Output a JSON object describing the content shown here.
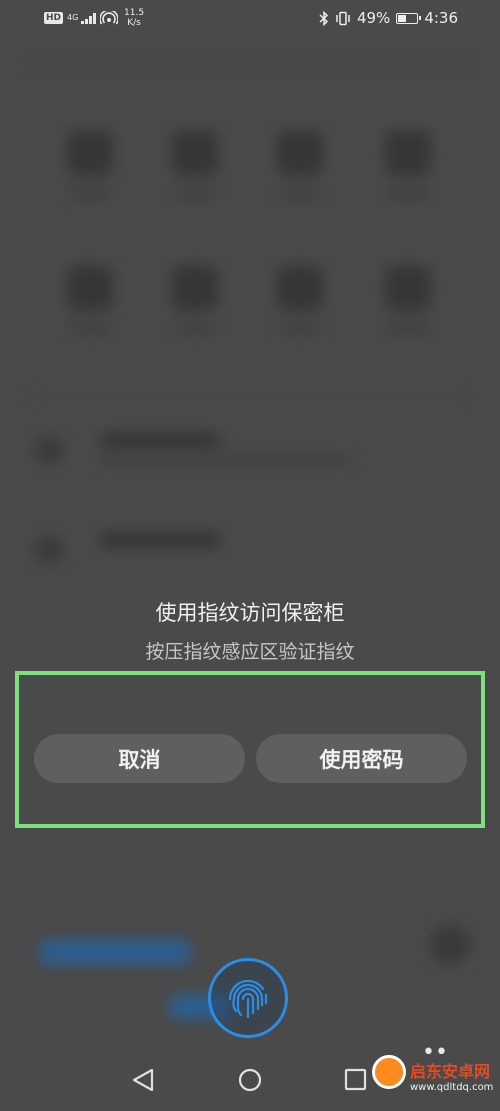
{
  "status_bar": {
    "hd": "HD",
    "network_type": "4G",
    "speed_value": "11.5",
    "speed_unit": "K/s",
    "battery_percent": "49%",
    "battery_level": 0.49,
    "time": "4:36"
  },
  "dialog": {
    "title": "使用指纹访问保密柜",
    "subtitle": "按压指纹感应区验证指纹",
    "cancel_label": "取消",
    "use_password_label": "使用密码"
  },
  "colors": {
    "highlight": "#7ee07f",
    "fingerprint": "#2a8ee6",
    "button_bg": "#5f5f5f",
    "overlay_bg": "#4a4a4a"
  },
  "icons": {
    "bluetooth": "bluetooth-icon",
    "vibrate": "vibrate-icon",
    "battery": "battery-icon",
    "hotspot": "hotspot-icon",
    "signal": "signal-icon",
    "fingerprint": "fingerprint-icon",
    "back": "back-triangle-icon",
    "home": "home-circle-icon",
    "recent": "recent-square-icon"
  },
  "watermark": {
    "name": "启东安卓网",
    "url": "www.qdltdq.com"
  }
}
